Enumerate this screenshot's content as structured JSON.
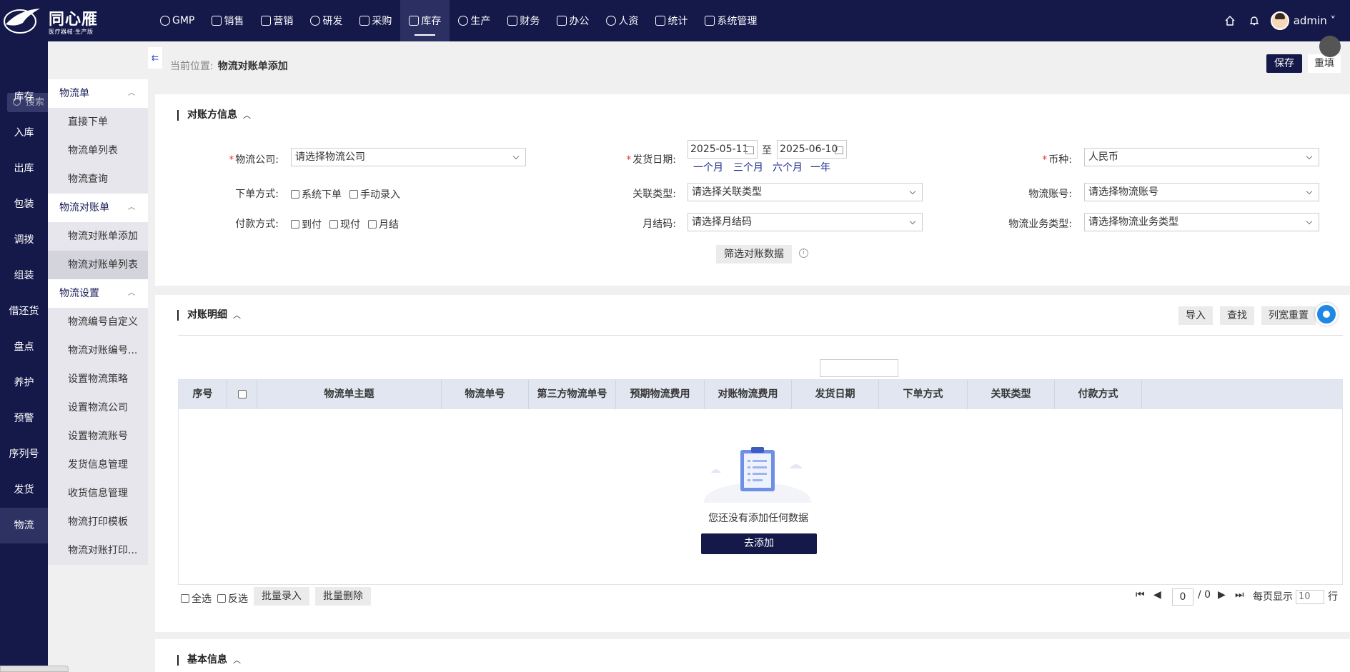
{
  "header": {
    "brand": "同心雁",
    "brand_sub": "医疗器械·生产版",
    "nav": [
      {
        "label": "GMP",
        "icon": "gmp-icon"
      },
      {
        "label": "销售",
        "icon": "sales-chart-icon"
      },
      {
        "label": "营销",
        "icon": "marketing-bar-icon"
      },
      {
        "label": "研发",
        "icon": "rocket-icon"
      },
      {
        "label": "采购",
        "icon": "shop-icon"
      },
      {
        "label": "库存",
        "icon": "inventory-icon",
        "active": true
      },
      {
        "label": "生产",
        "icon": "production-icon"
      },
      {
        "label": "财务",
        "icon": "yen-icon"
      },
      {
        "label": "办公",
        "icon": "briefcase-icon"
      },
      {
        "label": "人资",
        "icon": "person-icon"
      },
      {
        "label": "统计",
        "icon": "pie-icon"
      },
      {
        "label": "系统管理",
        "icon": "gear-icon"
      }
    ],
    "user": "admin"
  },
  "search": {
    "placeholder": "搜索"
  },
  "rail": [
    "库存",
    "入库",
    "出库",
    "包装",
    "调拨",
    "组装",
    "借还货",
    "盘点",
    "养护",
    "预警",
    "序列号",
    "发货",
    "物流"
  ],
  "rail_active": "物流",
  "submenu": {
    "group1": "物流单",
    "group1_items": [
      "直接下单",
      "物流单列表",
      "物流查询"
    ],
    "group2": "物流对账单",
    "group2_items": [
      "物流对账单添加",
      "物流对账单列表"
    ],
    "group3": "物流设置",
    "group3_items": [
      "物流编号自定义",
      "物流对账编号...",
      "设置物流策略",
      "设置物流公司",
      "设置物流账号",
      "发货信息管理",
      "收货信息管理",
      "物流打印模板",
      "物流对账打印..."
    ]
  },
  "breadcrumb": {
    "prefix": "当前位置:",
    "page": "物流对账单添加"
  },
  "actions": {
    "save": "保存",
    "reset": "重填"
  },
  "section1": {
    "title": "对账方信息",
    "logistics_company_label": "物流公司:",
    "logistics_company_value": "请选择物流公司",
    "ship_date_label": "发货日期:",
    "date_from": "2025-05-11",
    "date_to_sep": "至",
    "date_to": "2025-06-10",
    "quick_ranges": [
      "一个月",
      "三个月",
      "六个月",
      "一年"
    ],
    "currency_label": "币种:",
    "currency_value": "人民币",
    "order_method_label": "下单方式:",
    "order_methods": [
      "系统下单",
      "手动录入"
    ],
    "relation_type_label": "关联类型:",
    "relation_type_value": "请选择关联类型",
    "account_label": "物流账号:",
    "account_value": "请选择物流账号",
    "payment_label": "付款方式:",
    "payments": [
      "到付",
      "现付",
      "月结"
    ],
    "monthly_code_label": "月结码:",
    "monthly_code_value": "请选择月结码",
    "business_type_label": "物流业务类型:",
    "business_type_value": "请选择物流业务类型",
    "filter_button": "筛选对账数据"
  },
  "section2": {
    "title": "对账明细",
    "buttons": [
      "导入",
      "查找",
      "列宽重置"
    ],
    "columns": [
      "序号",
      "",
      "物流单主题",
      "物流单号",
      "第三方物流单号",
      "预期物流费用",
      "对账物流费用",
      "发货日期",
      "下单方式",
      "关联类型",
      "付款方式"
    ],
    "empty_text": "您还没有添加任何数据",
    "add_button": "去添加",
    "select_all": "全选",
    "invert": "反选",
    "batch_entry": "批量录入",
    "batch_delete": "批量删除",
    "page_current": "0",
    "page_total": "/ 0",
    "per_page_label": "每页显示",
    "per_page_value": "10",
    "per_page_unit": "行"
  },
  "section3": {
    "title": "基本信息"
  },
  "colors": {
    "primary": "#15194a",
    "accent": "#1b2a8f",
    "required": "#e33333"
  }
}
